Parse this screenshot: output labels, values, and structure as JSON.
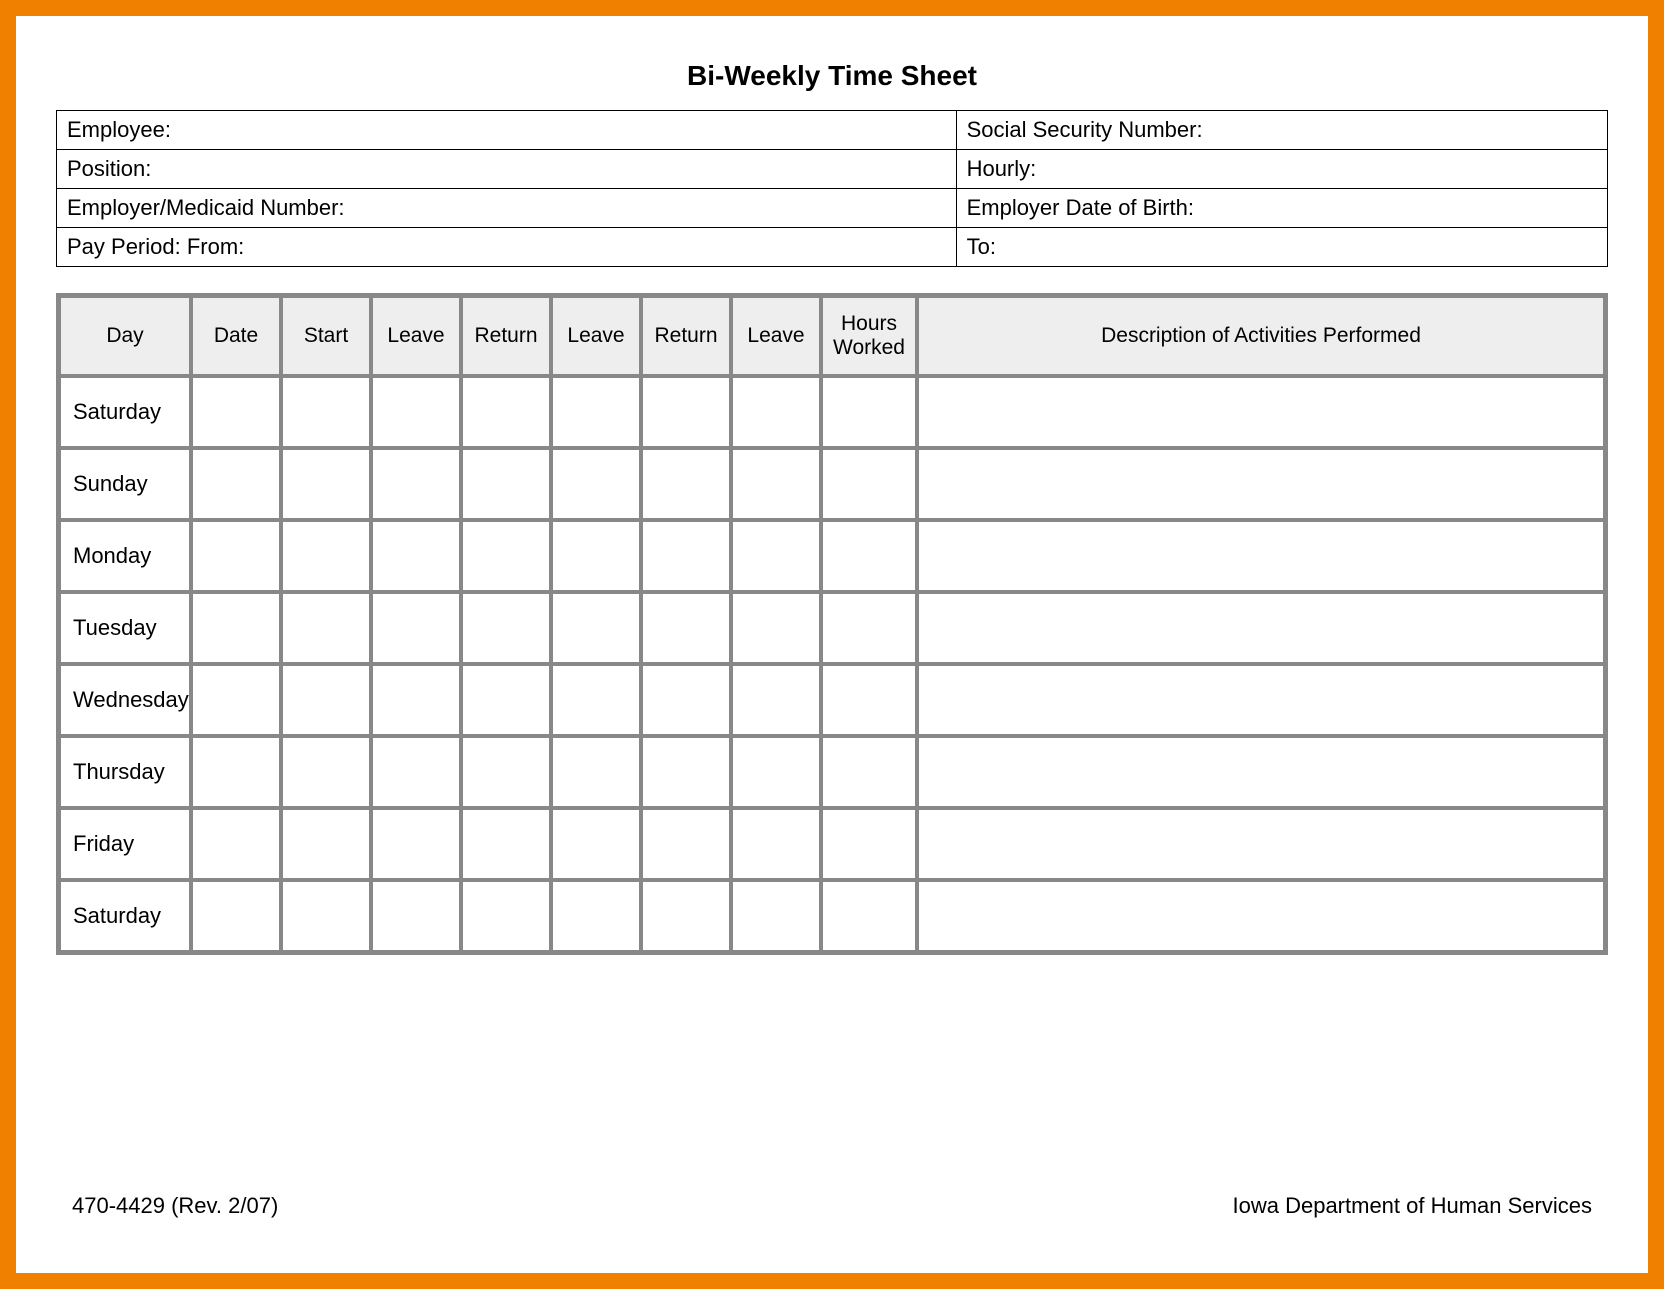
{
  "title": "Bi-Weekly Time Sheet",
  "info": {
    "employee_label": "Employee:",
    "ssn_label": "Social Security Number:",
    "position_label": "Position:",
    "hourly_label": "Hourly:",
    "employer_medicaid_label": "Employer/Medicaid Number:",
    "employer_dob_label": "Employer Date of Birth:",
    "pay_period_from_label": "Pay Period:  From:",
    "to_label": "To:"
  },
  "grid": {
    "headers": {
      "day": "Day",
      "date": "Date",
      "start": "Start",
      "leave1": "Leave",
      "return1": "Return",
      "leave2": "Leave",
      "return2": "Return",
      "leave3": "Leave",
      "hours": "Hours Worked",
      "desc": "Description of Activities Performed"
    },
    "days": [
      "Saturday",
      "Sunday",
      "Monday",
      "Tuesday",
      "Wednesday",
      "Thursday",
      "Friday",
      "Saturday"
    ]
  },
  "footer": {
    "left": "470-4429  (Rev. 2/07)",
    "right": "Iowa Department of Human Services"
  }
}
